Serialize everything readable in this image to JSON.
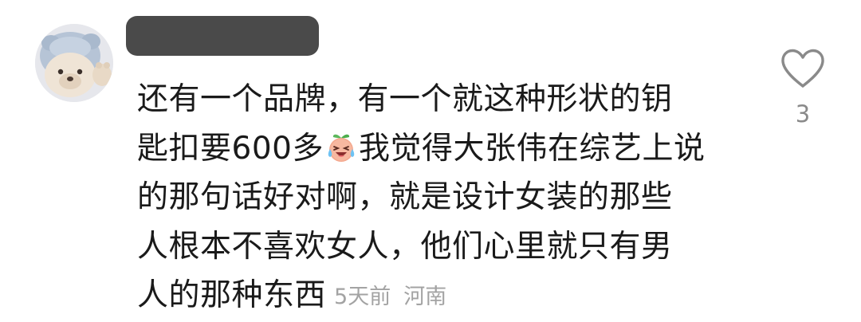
{
  "comment": {
    "lines": [
      "还有一个品牌，有一个就这种形状的钥",
      "匙扣要600多",
      "我觉得大张伟在综艺上说",
      "的那句话好对啊，就是设计女装的那些",
      "人根本不喜欢女人，他们心里就只有男",
      "人的那种东西"
    ],
    "emoji": "crying-laughing-emoji",
    "time": "5天前",
    "region": "河南"
  },
  "like": {
    "icon": "heart-outline-icon",
    "count": "3"
  },
  "colors": {
    "text": "#1a1a1a",
    "meta": "#a3a3a3",
    "like_count": "#8a8a8a",
    "username_redaction": "#4a4a4a"
  }
}
